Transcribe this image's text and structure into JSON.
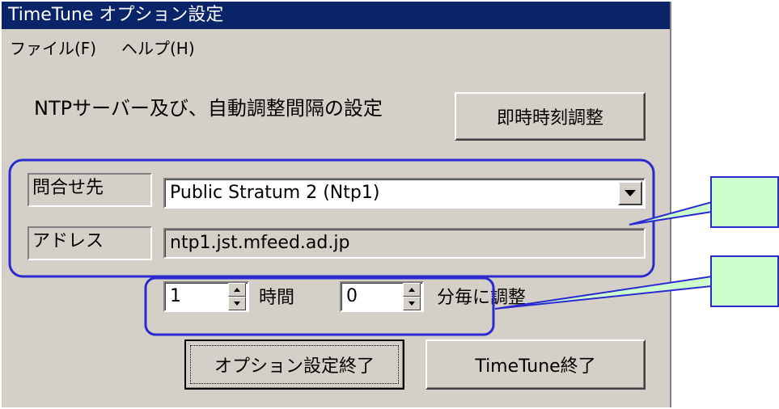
{
  "window": {
    "title": "TimeTune  オプション設定"
  },
  "menu": {
    "file": "ファイル(F)",
    "help": "ヘルプ(H)"
  },
  "main": {
    "heading": "NTPサーバー及び、自動調整間隔の設定",
    "instant_adjust_button": "即時時刻調整"
  },
  "server": {
    "query_label": "問合せ先",
    "query_value": "Public Stratum 2 (Ntp1)",
    "address_label": "アドレス",
    "address_value": "ntp1.jst.mfeed.ad.jp"
  },
  "interval": {
    "hours_value": "1",
    "hours_label": "時間",
    "minutes_value": "0",
    "minutes_label": "分毎に調整"
  },
  "buttons": {
    "end_options": "オプション設定終了",
    "end_app": "TimeTune終了"
  },
  "colors": {
    "titlebar": "#0a246a",
    "face": "#d4d0c8",
    "annotation_outline": "#2a2ad0",
    "callout_fill": "#ccffcc"
  }
}
